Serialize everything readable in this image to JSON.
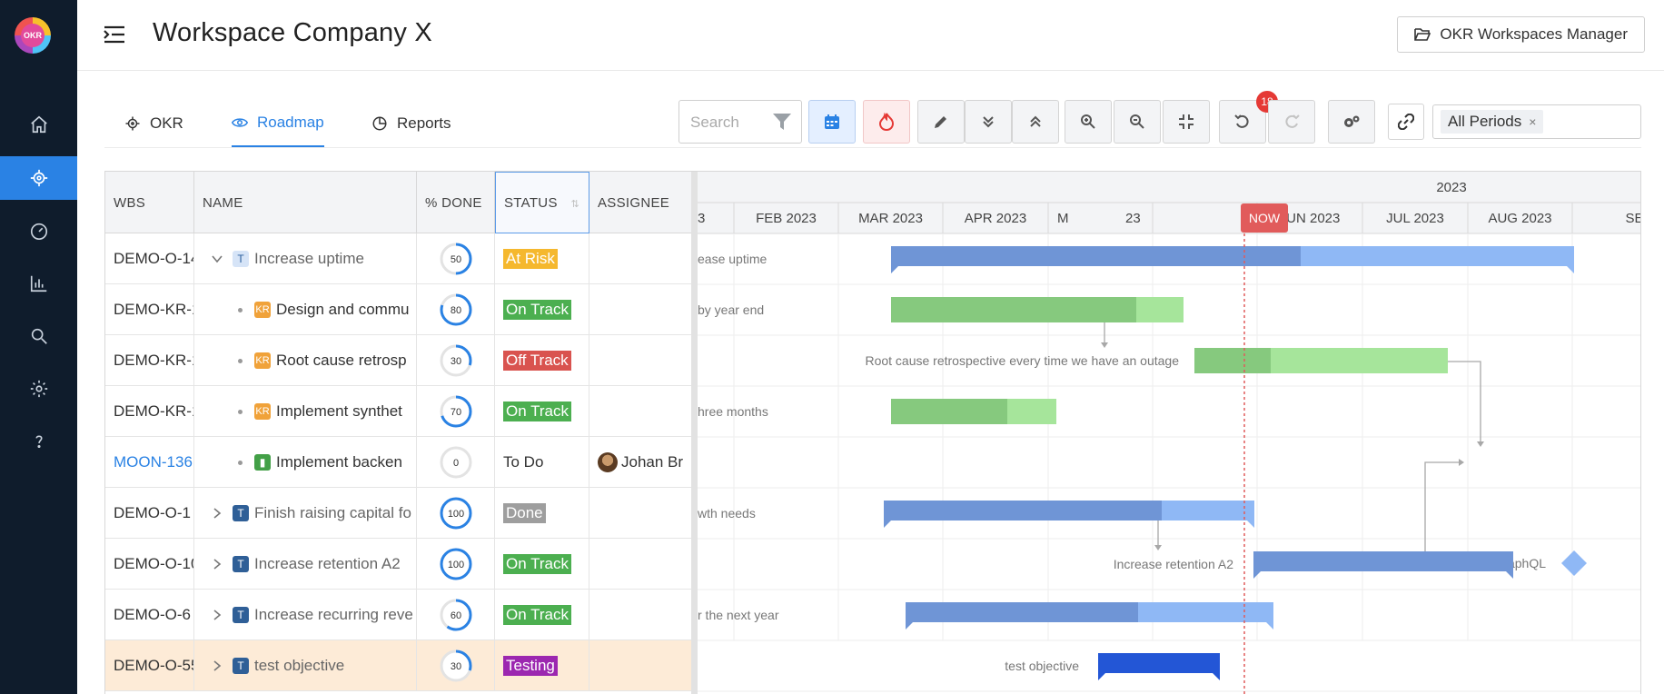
{
  "app": {
    "logo_text": "OKR"
  },
  "header": {
    "title": "Workspace Company X",
    "workspaces_button": "OKR Workspaces Manager"
  },
  "sidebar": {
    "items": [
      "home-icon",
      "target-icon",
      "dashboard-icon",
      "chart-icon",
      "search-icon",
      "gear-icon",
      "help-icon"
    ]
  },
  "tabs": [
    {
      "label": "OKR",
      "active": false
    },
    {
      "label": "Roadmap",
      "active": true
    },
    {
      "label": "Reports",
      "active": false
    }
  ],
  "toolbar": {
    "search_placeholder": "Search",
    "undo_badge": "18",
    "period_chip": "All Periods",
    "period_remove": "×"
  },
  "grid": {
    "columns": [
      "WBS",
      "NAME",
      "% DONE",
      "STATUS",
      "ASSIGNEE"
    ],
    "rows": [
      {
        "wbs": "DEMO-O-14",
        "name": "Increase uptime",
        "pct": 50,
        "status": "At Risk",
        "assignee": "",
        "type": "T"
      },
      {
        "wbs": "DEMO-KR-1",
        "name": "Design and commu",
        "pct": 80,
        "status": "On Track",
        "assignee": "",
        "type": "KR"
      },
      {
        "wbs": "DEMO-KR-1",
        "name": "Root cause retrosp",
        "pct": 30,
        "status": "Off Track",
        "assignee": "",
        "type": "KR"
      },
      {
        "wbs": "DEMO-KR-1",
        "name": "Implement synthet",
        "pct": 70,
        "status": "On Track",
        "assignee": "",
        "type": "KR"
      },
      {
        "wbs": "MOON-136",
        "name": "Implement backen",
        "pct": 0,
        "status": "To Do",
        "assignee": "Johan Br",
        "type": "G"
      },
      {
        "wbs": "DEMO-O-1",
        "name": "Finish raising capital fo",
        "pct": 100,
        "status": "Done",
        "assignee": "",
        "type": "T"
      },
      {
        "wbs": "DEMO-O-10",
        "name": "Increase retention A2",
        "pct": 100,
        "status": "On Track",
        "assignee": "",
        "type": "T"
      },
      {
        "wbs": "DEMO-O-6",
        "name": "Increase recurring reve",
        "pct": 60,
        "status": "On Track",
        "assignee": "",
        "type": "T"
      },
      {
        "wbs": "DEMO-O-55",
        "name": "test objective",
        "pct": 30,
        "status": "Testing",
        "assignee": "",
        "type": "T"
      }
    ]
  },
  "gantt": {
    "year": "2023",
    "months": [
      "3",
      "FEB 2023",
      "MAR 2023",
      "APR 2023",
      "M",
      "23",
      "JUN 2023",
      "JUL 2023",
      "AUG 2023",
      "SEP"
    ],
    "now_label": "NOW",
    "bar_labels": [
      "ease uptime",
      "by year end",
      "Root cause retrospective every time we have an outage",
      "hree months",
      "Implement backend support for graphQL",
      "wth needs",
      "Increase retention A2",
      "r the next year",
      "test objective"
    ]
  },
  "colors": {
    "accent": "#2a82e4",
    "sidebar": "#0f1c2c",
    "objective_dark": "#6f95d6",
    "objective_light": "#8fb8f5",
    "kr_dark": "#86c97e",
    "kr_light": "#a6e59b",
    "now": "#e15b5b",
    "selected_bar": "#2356d6"
  }
}
